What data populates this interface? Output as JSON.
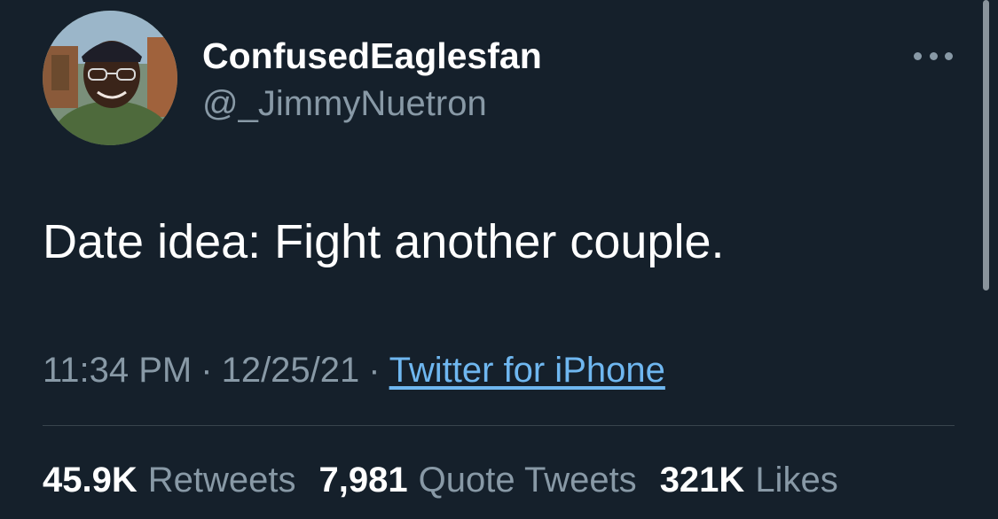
{
  "author": {
    "display_name": "ConfusedEaglesfan",
    "handle": "@_JimmyNuetron"
  },
  "tweet": {
    "text": "Date idea: Fight another couple."
  },
  "meta": {
    "time": "11:34 PM",
    "separator": "·",
    "date": "12/25/21",
    "source": "Twitter for iPhone"
  },
  "stats": {
    "retweets_count": "45.9K",
    "retweets_label": "Retweets",
    "quote_count": "7,981",
    "quote_label": "Quote Tweets",
    "likes_count": "321K",
    "likes_label": "Likes"
  },
  "icons": {
    "more": "more-horizontal-icon"
  },
  "colors": {
    "background": "#15202b",
    "secondary_text": "#8899a6",
    "link": "#6fb7f0",
    "divider": "#38444d"
  }
}
